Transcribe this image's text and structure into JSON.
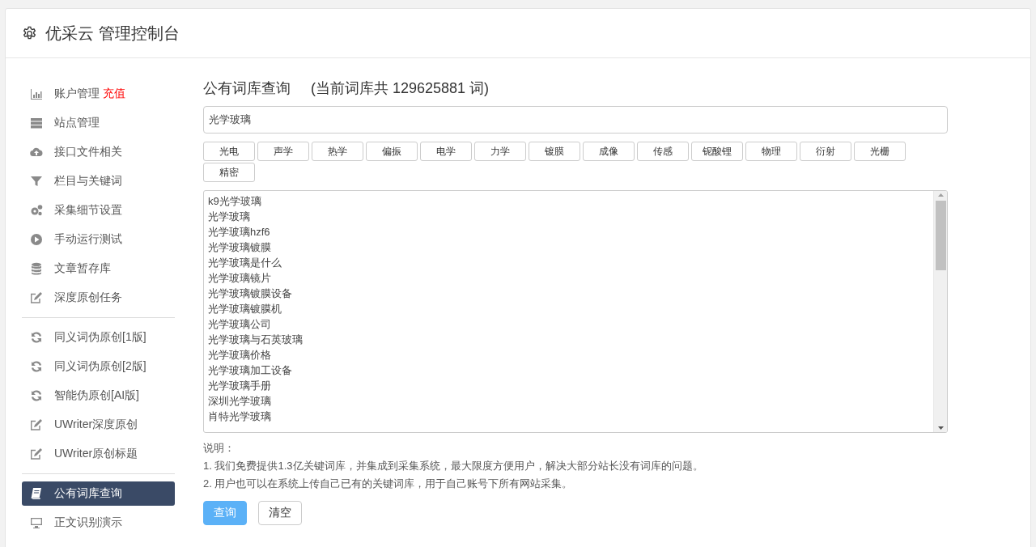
{
  "header": {
    "title": "优采云 管理控制台"
  },
  "sidebar": {
    "groups": [
      {
        "items": [
          {
            "label": "账户管理",
            "badge": "充值",
            "selected": false
          },
          {
            "label": "站点管理",
            "selected": false
          },
          {
            "label": "接口文件相关",
            "selected": false
          },
          {
            "label": "栏目与关键词",
            "selected": false
          },
          {
            "label": "采集细节设置",
            "selected": false
          },
          {
            "label": "手动运行测试",
            "selected": false
          },
          {
            "label": "文章暂存库",
            "selected": false
          },
          {
            "label": "深度原创任务",
            "selected": false
          }
        ]
      },
      {
        "items": [
          {
            "label": "同义词伪原创[1版]",
            "selected": false
          },
          {
            "label": "同义词伪原创[2版]",
            "selected": false
          },
          {
            "label": "智能伪原创[AI版]",
            "selected": false
          },
          {
            "label": "UWriter深度原创",
            "selected": false
          },
          {
            "label": "UWriter原创标题",
            "selected": false
          }
        ]
      },
      {
        "items": [
          {
            "label": "公有词库查询",
            "selected": true
          },
          {
            "label": "正文识别演示",
            "selected": false
          }
        ]
      }
    ]
  },
  "main": {
    "title": "公有词库查询",
    "count_note": "(当前词库共 129625881 词)",
    "search": {
      "value": "光学玻璃"
    },
    "tags": [
      "光电",
      "声学",
      "热学",
      "偏振",
      "电学",
      "力学",
      "镀膜",
      "成像",
      "传感",
      "铌酸锂",
      "物理",
      "衍射",
      "光栅",
      "精密"
    ],
    "results": [
      "k9光学玻璃",
      "光学玻璃",
      "光学玻璃hzf6",
      "光学玻璃镀膜",
      "光学玻璃是什么",
      "光学玻璃镜片",
      "光学玻璃镀膜设备",
      "光学玻璃镀膜机",
      "光学玻璃公司",
      "光学玻璃与石英玻璃",
      "光学玻璃价格",
      "光学玻璃加工设备",
      "光学玻璃手册",
      "深圳光学玻璃",
      "肖特光学玻璃"
    ],
    "notes": {
      "heading": "说明：",
      "lines": [
        "1. 我们免费提供1.3亿关键词库，并集成到采集系统，最大限度方便用户，解决大部分站长没有词库的问题。",
        "2. 用户也可以在系统上传自己已有的关键词库，用于自己账号下所有网站采集。"
      ]
    },
    "buttons": [
      {
        "label": "查询",
        "kind": "primary"
      },
      {
        "label": "清空",
        "kind": "default"
      }
    ]
  }
}
